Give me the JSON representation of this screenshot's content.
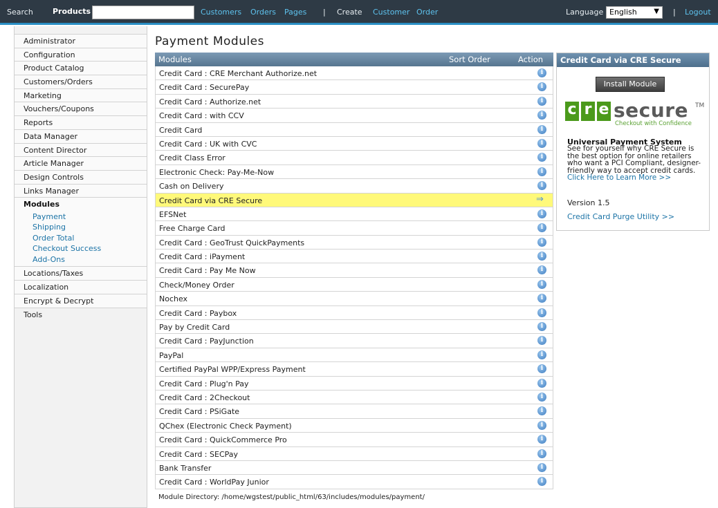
{
  "topbar": {
    "search_label": "Search",
    "search_scope": "Products",
    "search_value": "",
    "nav_links": [
      "Customers",
      "Orders",
      "Pages"
    ],
    "separator": "|",
    "create_label": "Create",
    "create_links": [
      "Customer",
      "Order"
    ],
    "language_label": "Language",
    "language_value": "English",
    "logout_label": "Logout"
  },
  "sidebar": {
    "items_top": [
      "Administrator",
      "Configuration",
      "Product Catalog",
      "Customers/Orders",
      "Marketing",
      "Vouchers/Coupons",
      "Reports",
      "Data Manager",
      "Content Director",
      "Article Manager",
      "Design Controls",
      "Links Manager"
    ],
    "active_item": "Modules",
    "sub_items": [
      "Payment",
      "Shipping",
      "Order Total",
      "Checkout Success",
      "Add-Ons"
    ],
    "items_bottom": [
      "Locations/Taxes",
      "Localization",
      "Encrypt & Decrypt",
      "Tools"
    ]
  },
  "page": {
    "title": "Payment Modules"
  },
  "table": {
    "headers": {
      "modules": "Modules",
      "sort_order": "Sort Order",
      "action": "Action"
    },
    "rows": [
      "Credit Card : CRE Merchant Authorize.net",
      "Credit Card : SecurePay",
      "Credit Card : Authorize.net",
      "Credit Card : with CCV",
      "Credit Card",
      "Credit Card : UK with CVC",
      "Credit Class Error",
      "Electronic Check: Pay-Me-Now",
      "Cash on Delivery",
      "Credit Card via CRE Secure",
      "EFSNet",
      "Free Charge Card",
      "Credit Card : GeoTrust QuickPayments",
      "Credit Card : iPayment",
      "Credit Card : Pay Me Now",
      "Check/Money Order",
      "Nochex",
      "Credit Card : Paybox",
      "Pay by Credit Card",
      "Credit Card : PayJunction",
      "PayPal",
      "Certified PayPal WPP/Express Payment",
      "Credit Card : Plug'n Pay",
      "Credit Card : 2Checkout",
      "Credit Card : PSiGate",
      "QChex (Electronic Check Payment)",
      "Credit Card : QuickCommerce Pro",
      "Credit Card : SECPay",
      "Bank Transfer",
      "Credit Card : WorldPay Junior"
    ],
    "selected_index": 9,
    "info_glyph": "i",
    "arrow_glyph": "⇒",
    "module_directory": "Module Directory: /home/wgstest/public_html/63/includes/modules/payment/"
  },
  "panel": {
    "title": "Credit Card via CRE Secure",
    "install_button": "Install Module",
    "logo": {
      "letters": [
        "c",
        "r",
        "e"
      ],
      "word": "secure",
      "tm": "TM",
      "tagline": "Checkout with Confidence",
      "brand_color": "#4b9a1b"
    },
    "ups_title": "Universal Payment System",
    "ups_text": "See for yourself why CRE Secure is the best option for online retailers who want a PCI Compliant, designer-friendly way to accept credit cards.",
    "ups_link": "Click Here to Learn More >>",
    "version": "Version 1.5",
    "purge_link": "Credit Card Purge Utility >>"
  },
  "colors": {
    "topbar_bg": "#2e3a45",
    "link": "#1b73a6",
    "header_bg": "#6a8aa6",
    "selected_row": "#fff97a",
    "info_icon": "#3d7cc0"
  }
}
